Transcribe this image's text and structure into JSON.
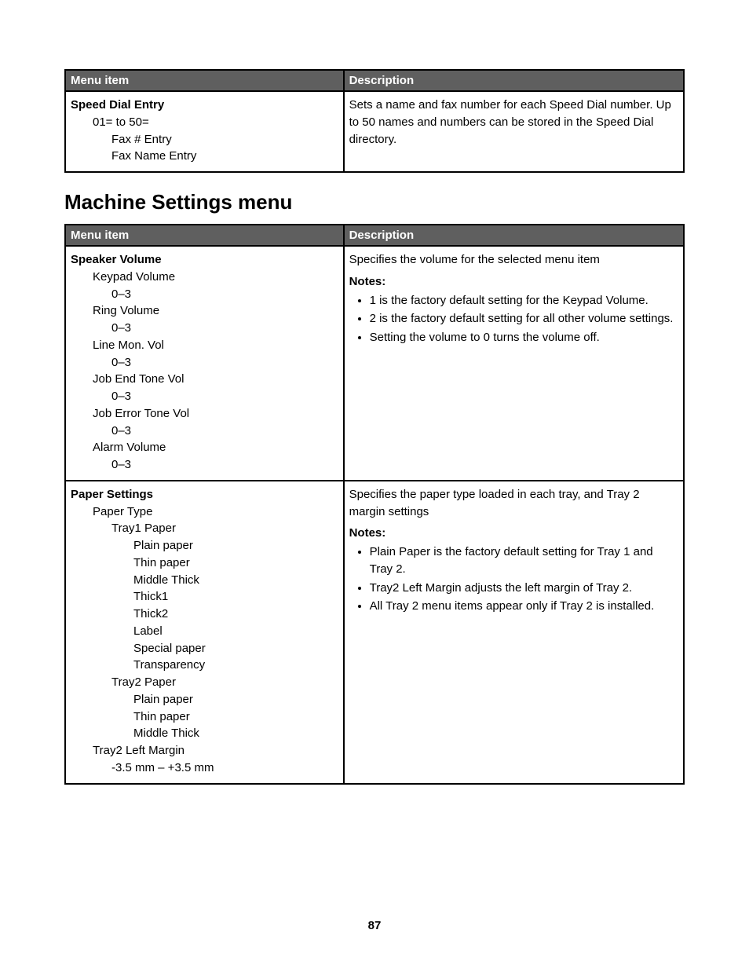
{
  "table1": {
    "header_menu": "Menu item",
    "header_desc": "Description",
    "row": {
      "title": "Speed Dial Entry",
      "line1": "01= to 50=",
      "line2": "Fax # Entry",
      "line3": "Fax Name Entry",
      "description": "Sets a name and fax number for each Speed Dial number. Up to 50 names and numbers can be stored in the Speed Dial directory."
    }
  },
  "section_title": "Machine Settings menu",
  "table2": {
    "header_menu": "Menu item",
    "header_desc": "Description",
    "row1": {
      "title": "Speaker Volume",
      "i1": "Keypad Volume",
      "i1r": "0–3",
      "i2": "Ring Volume",
      "i2r": "0–3",
      "i3": "Line Mon. Vol",
      "i3r": "0–3",
      "i4": "Job End Tone Vol",
      "i4r": "0–3",
      "i5": "Job Error Tone Vol",
      "i5r": "0–3",
      "i6": "Alarm Volume",
      "i6r": "0–3",
      "desc_intro": "Specifies the volume for the selected menu item",
      "notes_label": "Notes:",
      "n1": "1 is the factory default setting for the Keypad Volume.",
      "n2": "2 is the factory default setting for all other volume settings.",
      "n3": "Setting the volume to 0 turns the volume off."
    },
    "row2": {
      "title": "Paper Settings",
      "pt": "Paper Type",
      "t1": "Tray1 Paper",
      "t1a": "Plain paper",
      "t1b": "Thin paper",
      "t1c": "Middle Thick",
      "t1d": "Thick1",
      "t1e": "Thick2",
      "t1f": "Label",
      "t1g": "Special paper",
      "t1h": "Transparency",
      "t2": "Tray2 Paper",
      "t2a": "Plain paper",
      "t2b": "Thin paper",
      "t2c": "Middle Thick",
      "tlm": "Tray2 Left Margin",
      "tlmr": "-3.5 mm – +3.5 mm",
      "desc_intro": "Specifies the paper type loaded in each tray, and Tray 2 margin settings",
      "notes_label": "Notes:",
      "n1": "Plain Paper is the factory default setting for Tray 1 and Tray 2.",
      "n2": "Tray2 Left Margin adjusts the left margin of Tray 2.",
      "n3": "All Tray 2 menu items appear only if Tray 2 is installed."
    }
  },
  "page_number": "87"
}
